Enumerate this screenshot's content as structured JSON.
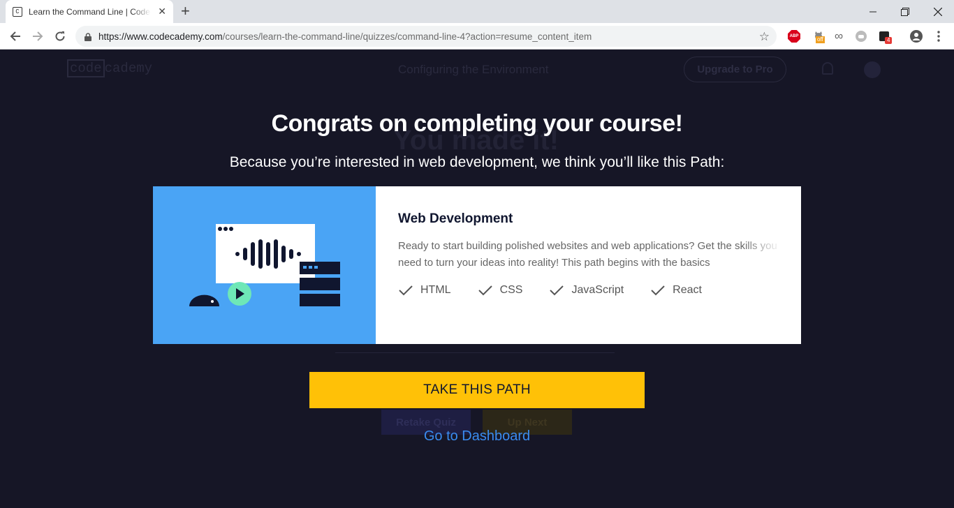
{
  "browser": {
    "tab_title": "Learn the Command Line | Codecademy",
    "favicon_letter": "C",
    "url_host": "https://www.codecademy.com",
    "url_path": "/courses/learn-the-command-line/quizzes/command-line-4?action=resume_content_item",
    "extension_badges": {
      "abp": "ABP",
      "off": "off",
      "count": "4"
    }
  },
  "background_page": {
    "logo_code": "code",
    "logo_cademy": "cademy",
    "lesson_title": "Configuring the Environment",
    "upgrade_button": "Upgrade to Pro",
    "heading": "You made it!",
    "retake_button": "Retake Quiz",
    "up_next_button": "Up Next"
  },
  "modal": {
    "headline": "Congrats on completing your course!",
    "subhead": "Because you’re interested in web development, we think you’ll like this Path:",
    "path": {
      "title": "Web Development",
      "description": "Ready to start building polished websites and web applications? Get the skills you need to turn your ideas into reality! This path begins with the basics",
      "tags": [
        "HTML",
        "CSS",
        "JavaScript",
        "React"
      ]
    },
    "cta_label": "TAKE THIS PATH",
    "dashboard_link": "Go to Dashboard"
  },
  "colors": {
    "overlay": "#161626",
    "accent_yellow": "#ffc107",
    "link_blue": "#3a8cf0",
    "art_blue": "#4aa4f5",
    "navy": "#10162f"
  }
}
